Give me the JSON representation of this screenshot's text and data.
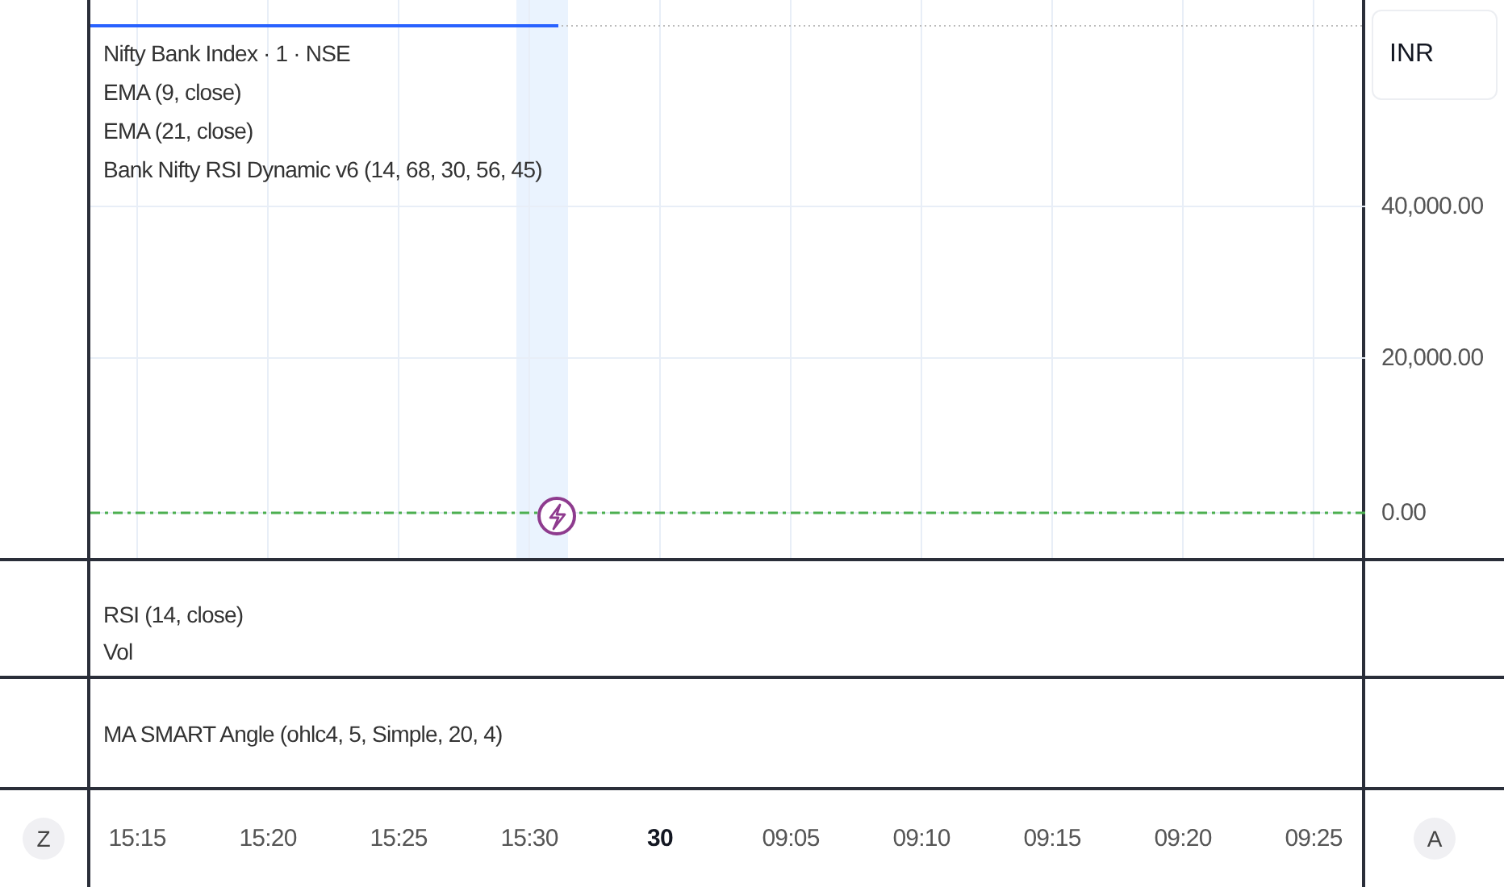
{
  "main_pane": {
    "legend": [
      "Nifty Bank Index · 1 · NSE",
      "EMA (9, close)",
      "EMA (21, close)",
      "Bank Nifty RSI Dynamic v6 (14, 68, 30, 56, 45)"
    ]
  },
  "price_axis": {
    "currency": "INR",
    "ticks": [
      "40,000.00",
      "20,000.00",
      "0.00"
    ]
  },
  "rsi_pane": {
    "legend": [
      "RSI (14, close)",
      "Vol"
    ]
  },
  "ma_pane": {
    "legend": [
      "MA SMART Angle (ohlc4, 5, Simple, 20, 4)"
    ]
  },
  "time_axis": {
    "left_button": "Z",
    "right_button": "A",
    "labels": [
      {
        "label": "15:15",
        "kind": "time"
      },
      {
        "label": "15:20",
        "kind": "time"
      },
      {
        "label": "15:25",
        "kind": "time"
      },
      {
        "label": "15:30",
        "kind": "time"
      },
      {
        "label": "30",
        "kind": "day"
      },
      {
        "label": "09:05",
        "kind": "time"
      },
      {
        "label": "09:10",
        "kind": "time"
      },
      {
        "label": "09:15",
        "kind": "time"
      },
      {
        "label": "09:20",
        "kind": "time"
      },
      {
        "label": "09:25",
        "kind": "time"
      }
    ]
  }
}
